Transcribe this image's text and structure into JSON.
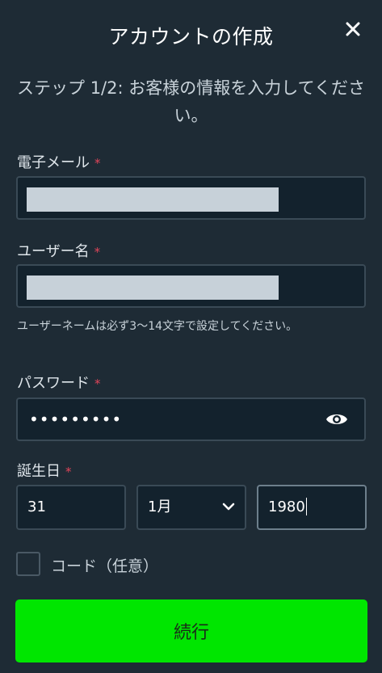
{
  "header": {
    "title": "アカウントの作成",
    "close_icon": "close-icon"
  },
  "step_text": "ステップ 1/2: お客様の情報を入力してください。",
  "fields": {
    "email": {
      "label": "電子メール",
      "required_mark": "*"
    },
    "username": {
      "label": "ユーザー名",
      "required_mark": "*",
      "hint": "ユーザーネームは必ず3〜14文字で設定してください。"
    },
    "password": {
      "label": "パスワード",
      "required_mark": "*",
      "value_masked": "•••••••••",
      "toggle_icon": "eye-icon"
    },
    "birthdate": {
      "label": "誕生日",
      "required_mark": "*",
      "day": "31",
      "month": "1月",
      "year": "1980"
    }
  },
  "code_option": {
    "label": "コード（任意）",
    "checked": false
  },
  "continue_button": {
    "label": "続行"
  },
  "colors": {
    "background": "#1e2b35",
    "input_background": "#13222d",
    "required": "#e0455a",
    "primary_button": "#00e600"
  }
}
